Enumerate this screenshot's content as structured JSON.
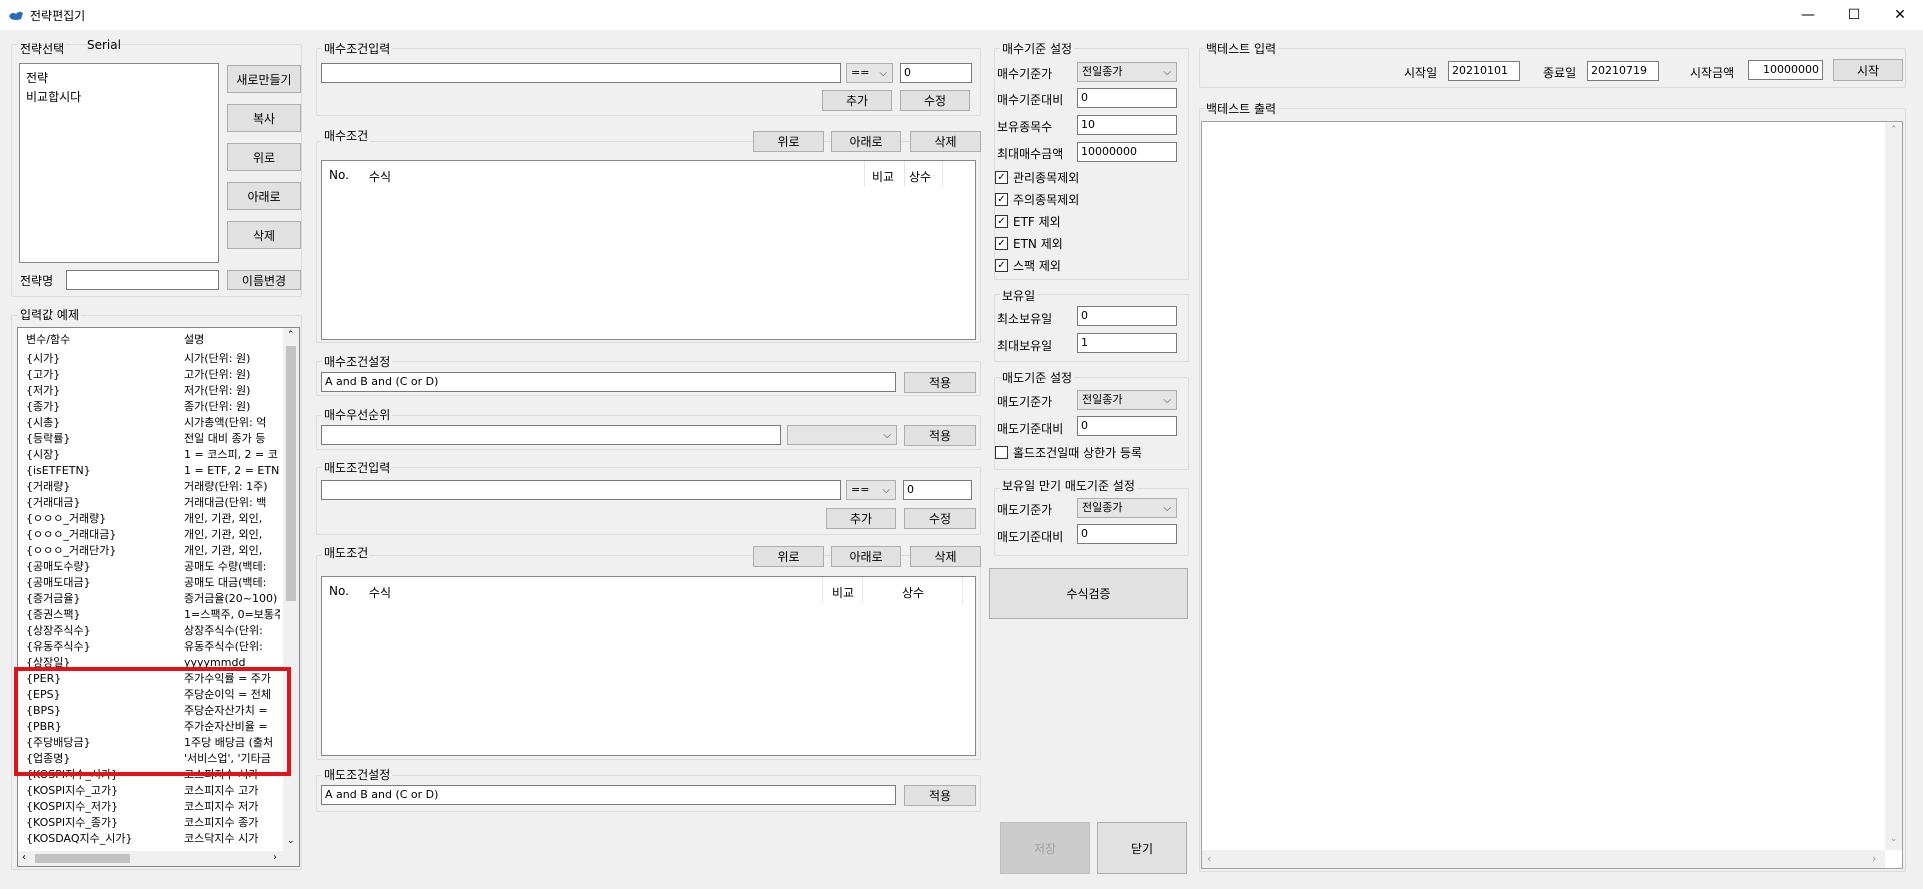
{
  "window": {
    "title": "전략편집기",
    "min": "—",
    "max": "☐",
    "close": "✕"
  },
  "strategy": {
    "group_label": "전략선택",
    "serial_label": "Serial",
    "items": [
      "전략",
      "비교합시다"
    ],
    "buttons": {
      "new": "새로만들기",
      "copy": "복사",
      "up": "위로",
      "down": "아래로",
      "delete": "삭제"
    },
    "name_label": "전략명",
    "name_value": "",
    "rename": "이름변경"
  },
  "examples": {
    "group_label": "입력값 예제",
    "headers": [
      "변수/함수",
      "설명"
    ],
    "rows": [
      [
        "{시가}",
        "시가(단위: 원)"
      ],
      [
        "{고가}",
        "고가(단위: 원)"
      ],
      [
        "{저가}",
        "저가(단위: 원)"
      ],
      [
        "{종가}",
        "종가(단위: 원)"
      ],
      [
        "{시총}",
        "시가총액(단위: 억"
      ],
      [
        "{등락률}",
        "전일 대비 종가 등"
      ],
      [
        "{시장}",
        "1 = 코스피, 2 = 코"
      ],
      [
        "{isETFETN}",
        "1 = ETF, 2 = ETN"
      ],
      [
        "{거래량}",
        "거래량(단위: 1주)"
      ],
      [
        "{거래대금}",
        "거래대금(단위: 백"
      ],
      [
        "{ㅇㅇㅇ_거래량}",
        "개인, 기관, 외인,"
      ],
      [
        "{ㅇㅇㅇ_거래대금}",
        "개인, 기관, 외인,"
      ],
      [
        "{ㅇㅇㅇ_거래단가}",
        "개인, 기관, 외인,"
      ],
      [
        "{공매도수량}",
        "공매도 수량(백테:"
      ],
      [
        "{공매도대금}",
        "공매도 대금(백테:"
      ],
      [
        "{증거금율}",
        "증거금율(20~100)"
      ],
      [
        "{증권스팩}",
        "1=스팩주, 0=보통주"
      ],
      [
        "{상장주식수}",
        "상장주식수(단위:"
      ],
      [
        "{유동주식수}",
        "유동주식수(단위:"
      ],
      [
        "{상장일}",
        "yyyymmdd"
      ],
      [
        "{PER}",
        "주가수익률 = 주가"
      ],
      [
        "{EPS}",
        "주당순이익 = 전체"
      ],
      [
        "{BPS}",
        "주당순자산가치 ="
      ],
      [
        "{PBR}",
        "주가순자산비율 ="
      ],
      [
        "{주당배당금}",
        "1주당 배당금 (출처"
      ],
      [
        "{업종명}",
        "'서비스업', '기타금"
      ],
      [
        "{KOSPI지수_시가}",
        "코스피지수 시가"
      ],
      [
        "{KOSPI지수_고가}",
        "코스피지수 고가"
      ],
      [
        "{KOSPI지수_저가}",
        "코스피지수 저가"
      ],
      [
        "{KOSPI지수_종가}",
        "코스피지수 종가"
      ],
      [
        "{KOSDAQ지수_시가}",
        "코스닥지수 시가"
      ]
    ]
  },
  "buy_input": {
    "group_label": "매수조건입력",
    "expr": "",
    "op": "==",
    "value": "0",
    "add": "추가",
    "edit": "수정"
  },
  "buy_conditions": {
    "group_label": "매수조건",
    "up": "위로",
    "down": "아래로",
    "delete": "삭제",
    "headers": [
      "No.",
      "수식",
      "비교",
      "상수"
    ]
  },
  "buy_setting": {
    "group_label": "매수조건설정",
    "value": "A and B and (C or D)",
    "apply": "적용"
  },
  "buy_priority": {
    "group_label": "매수우선순위",
    "value": "",
    "select": "",
    "apply": "적용"
  },
  "sell_input": {
    "group_label": "매도조건입력",
    "expr": "",
    "op": "==",
    "value": "0",
    "add": "추가",
    "edit": "수정"
  },
  "sell_conditions": {
    "group_label": "매도조건",
    "up": "위로",
    "down": "아래로",
    "delete": "삭제",
    "headers": [
      "No.",
      "수식",
      "비교",
      "상수"
    ]
  },
  "sell_setting": {
    "group_label": "매도조건설정",
    "value": "A and B and (C or D)",
    "apply": "적용"
  },
  "buy_base": {
    "group_label": "매수기준 설정",
    "price_label": "매수기준가",
    "price_value": "전일종가",
    "ratio_label": "매수기준대비",
    "ratio_value": "0",
    "hold_count_label": "보유종목수",
    "hold_count_value": "10",
    "max_amount_label": "최대매수금액",
    "max_amount_value": "10000000",
    "checks": [
      {
        "label": "관리종목제외",
        "checked": true
      },
      {
        "label": "주의종목제외",
        "checked": true
      },
      {
        "label": "ETF 제외",
        "checked": true
      },
      {
        "label": "ETN 제외",
        "checked": true
      },
      {
        "label": "스팩 제외",
        "checked": true
      }
    ]
  },
  "holding": {
    "group_label": "보유일",
    "min_label": "최소보유일",
    "min_value": "0",
    "max_label": "최대보유일",
    "max_value": "1"
  },
  "sell_base": {
    "group_label": "매도기준 설정",
    "price_label": "매도기준가",
    "price_value": "전일종가",
    "ratio_label": "매도기준대비",
    "ratio_value": "0",
    "check_label": "홀드조건일때 상한가 등록",
    "checked": false
  },
  "expiry_sell": {
    "group_label": "보유일 만기 매도기준 설정",
    "price_label": "매도기준가",
    "price_value": "전일종가",
    "ratio_label": "매도기준대비",
    "ratio_value": "0"
  },
  "verify": "수식검증",
  "save": "저장",
  "close": "닫기",
  "backtest_input": {
    "group_label": "백테스트 입력",
    "start_label": "시작일",
    "start_value": "20210101",
    "end_label": "종료일",
    "end_value": "20210719",
    "amount_label": "시작금액",
    "amount_value": "10000000",
    "start_button": "시작"
  },
  "backtest_output": {
    "group_label": "백테스트 출력"
  },
  "colors": {
    "highlight": "#e0121a",
    "background": "#f0f0f0"
  }
}
